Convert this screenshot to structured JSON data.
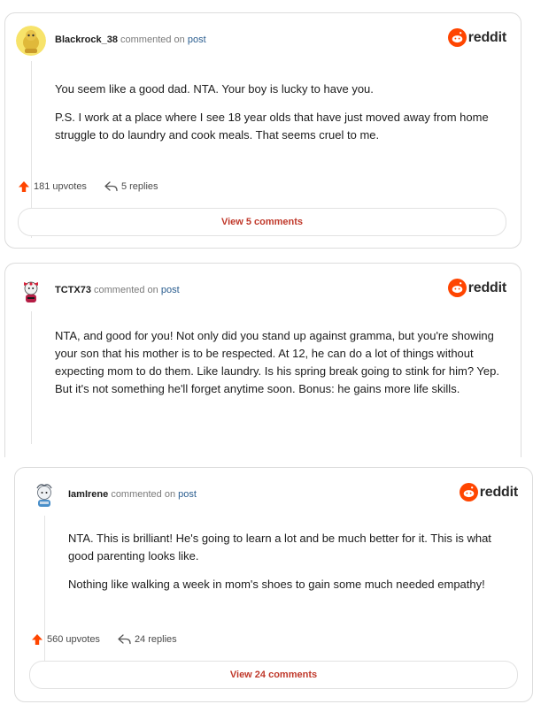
{
  "brand": {
    "word": "reddit",
    "color": "#ff4500"
  },
  "comments": [
    {
      "username": "Blackrock_38",
      "action": "commented on",
      "link": "post",
      "avatar": "yellow-snoo-avatar",
      "paragraphs": [
        "You seem like a good dad. NTA. Your boy is lucky to have you.",
        "P.S. I work at a place where I see 18 year olds that have just moved away from home struggle to do laundry and cook meals. That seems cruel to me."
      ],
      "upvotes": "181 upvotes",
      "replies": "5 replies",
      "view_button": "View 5 comments"
    },
    {
      "username": "TCTX73",
      "action": "commented on",
      "link": "post",
      "avatar": "red-bow-snoo-avatar",
      "paragraphs": [
        "NTA, and good for you! Not only did you stand up against gramma, but you're showing your son that his mother is to be respected. At 12, he can do a lot of things without expecting mom to do them. Like laundry. Is his spring break going to stink for him? Yep. But it's not something he'll forget anytime soon. Bonus: he gains more life skills."
      ]
    },
    {
      "username": "IamIrene",
      "action": "commented on",
      "link": "post",
      "avatar": "gray-snoo-avatar",
      "paragraphs": [
        "NTA. This is brilliant! He's going to learn a lot and be much better for it. This is what good parenting looks like.",
        "Nothing like walking a week in mom's shoes to gain some much needed empathy!"
      ],
      "upvotes": "560 upvotes",
      "replies": "24 replies",
      "view_button": "View 24 comments"
    }
  ]
}
